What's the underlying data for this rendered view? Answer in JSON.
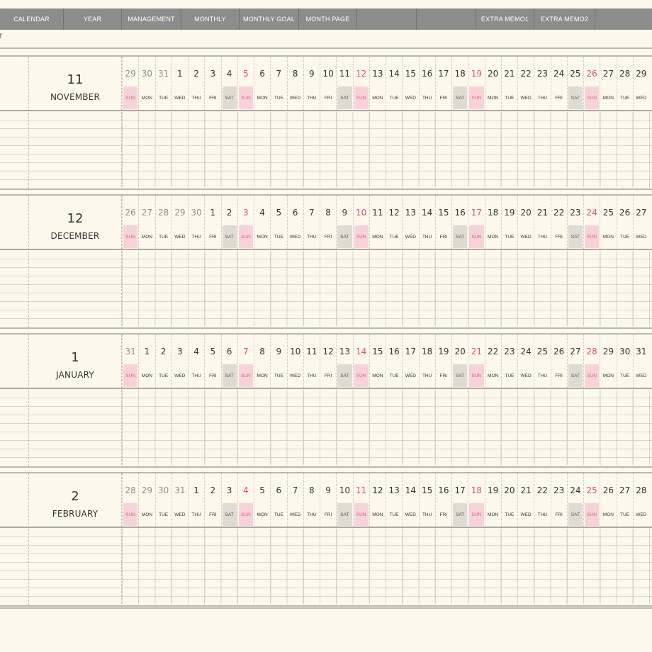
{
  "tabs": [
    {
      "label": "CALENDAR",
      "w": 90
    },
    {
      "label": "YEAR",
      "w": 82
    },
    {
      "label": "MANAGEMENT",
      "w": 84
    },
    {
      "label": "MONTHLY",
      "w": 82
    },
    {
      "label": "MONTHLY GOAL",
      "w": 84
    },
    {
      "label": "MONTH PAGE",
      "w": 82
    },
    {
      "label": "",
      "w": 84
    },
    {
      "label": "",
      "w": 84
    },
    {
      "label": "EXTRA MEMO1",
      "w": 82
    },
    {
      "label": "EXTRA MEMO2",
      "w": 86
    }
  ],
  "crumb": "T",
  "months": [
    {
      "number": "11",
      "name": "NOVEMBER",
      "days": [
        "29",
        "30",
        "31",
        "1",
        "2",
        "3",
        "4",
        "5",
        "6",
        "7",
        "8",
        "9",
        "10",
        "11",
        "12",
        "13",
        "14",
        "15",
        "16",
        "17",
        "18",
        "19",
        "20",
        "21",
        "22",
        "23",
        "24",
        "25",
        "26",
        "27",
        "28",
        "29"
      ],
      "weekdays": [
        "SUN",
        "MON",
        "TUE",
        "WED",
        "THU",
        "FRI",
        "SAT",
        "SUN",
        "MON",
        "TUE",
        "WED",
        "THU",
        "FRI",
        "SAT",
        "SUN",
        "MON",
        "TUE",
        "WED",
        "THU",
        "FRI",
        "SAT",
        "SUN",
        "MON",
        "TUE",
        "WED",
        "THU",
        "FRI",
        "SAT",
        "SUN",
        "MON",
        "TUE",
        "WED"
      ],
      "prev_count": 3
    },
    {
      "number": "12",
      "name": "DECEMBER",
      "days": [
        "26",
        "27",
        "28",
        "29",
        "30",
        "1",
        "2",
        "3",
        "4",
        "5",
        "6",
        "7",
        "8",
        "9",
        "10",
        "11",
        "12",
        "13",
        "14",
        "15",
        "16",
        "17",
        "18",
        "19",
        "20",
        "21",
        "22",
        "23",
        "24",
        "25",
        "26",
        "27"
      ],
      "weekdays": [
        "SUN",
        "MON",
        "TUE",
        "WED",
        "THU",
        "FRI",
        "SAT",
        "SUN",
        "MON",
        "TUE",
        "WED",
        "THU",
        "FRI",
        "SAT",
        "SUN",
        "MON",
        "TUE",
        "WED",
        "THU",
        "FRI",
        "SAT",
        "SUN",
        "MON",
        "TUE",
        "WED",
        "THU",
        "FRI",
        "SAT",
        "SUN",
        "MON",
        "TUE",
        "WED"
      ],
      "prev_count": 5
    },
    {
      "number": "1",
      "name": "JANUARY",
      "days": [
        "31",
        "1",
        "2",
        "3",
        "4",
        "5",
        "6",
        "7",
        "8",
        "9",
        "10",
        "11",
        "12",
        "13",
        "14",
        "15",
        "16",
        "17",
        "18",
        "19",
        "20",
        "21",
        "22",
        "23",
        "24",
        "25",
        "26",
        "27",
        "28",
        "29",
        "30",
        "31"
      ],
      "weekdays": [
        "SUN",
        "MON",
        "TUE",
        "WED",
        "THU",
        "FRI",
        "SAT",
        "SUN",
        "MON",
        "TUE",
        "WED",
        "THU",
        "FRI",
        "SAT",
        "SUN",
        "MON",
        "TUE",
        "WED",
        "THU",
        "FRI",
        "SAT",
        "SUN",
        "MON",
        "TUE",
        "WED",
        "THU",
        "FRI",
        "SAT",
        "SUN",
        "MON",
        "TUE",
        "WED"
      ],
      "prev_count": 1
    },
    {
      "number": "2",
      "name": "FEBRUARY",
      "days": [
        "28",
        "29",
        "30",
        "31",
        "1",
        "2",
        "3",
        "4",
        "5",
        "6",
        "7",
        "8",
        "9",
        "10",
        "11",
        "12",
        "13",
        "14",
        "15",
        "16",
        "17",
        "18",
        "19",
        "20",
        "21",
        "22",
        "23",
        "24",
        "25",
        "26",
        "27",
        "28"
      ],
      "weekdays": [
        "SUN",
        "MON",
        "TUE",
        "WED",
        "THU",
        "FRI",
        "SAT",
        "SUN",
        "MON",
        "TUE",
        "WED",
        "THU",
        "FRI",
        "SAT",
        "SUN",
        "MON",
        "TUE",
        "WED",
        "THU",
        "FRI",
        "SAT",
        "SUN",
        "MON",
        "TUE",
        "WED",
        "THU",
        "FRI",
        "SAT",
        "SUN",
        "MON",
        "TUE",
        "WED"
      ],
      "prev_count": 4
    }
  ],
  "colors": {
    "tabbar": "#8a8d8b",
    "sunday": "#d94f72",
    "sunday_bg": "#f7d3d9",
    "saturday_bg": "#dedbd2",
    "paper": "#fdf8ec"
  }
}
